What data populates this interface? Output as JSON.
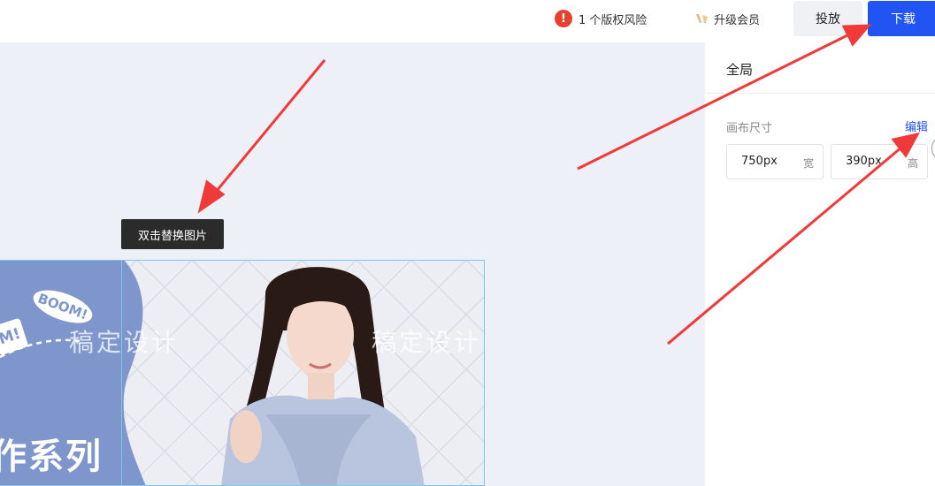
{
  "topbar": {
    "risk_icon": "!",
    "risk_label": "1 个版权风险",
    "vip_label": "升级会员",
    "put_label": "投放",
    "download_label": "下载"
  },
  "panel": {
    "title": "全局",
    "size_label": "画布尺寸",
    "edit_label": "编辑",
    "width_value": "750px",
    "width_unit": "宽",
    "height_value": "390px",
    "height_unit": "高"
  },
  "canvas": {
    "tooltip": "双击替换图片",
    "boom_text": "BOOM!",
    "m_text": "M!",
    "series_text": "作系列",
    "watermark_1": "稿定设计",
    "watermark_2": "稿定设计"
  },
  "colors": {
    "accent": "#2254f4",
    "danger": "#e5412f",
    "arrow": "#f03a3a",
    "banner_blue": "#7f96cd"
  },
  "icons": {
    "risk": "exclamation-circle-icon",
    "vip": "vip-crown-icon"
  }
}
